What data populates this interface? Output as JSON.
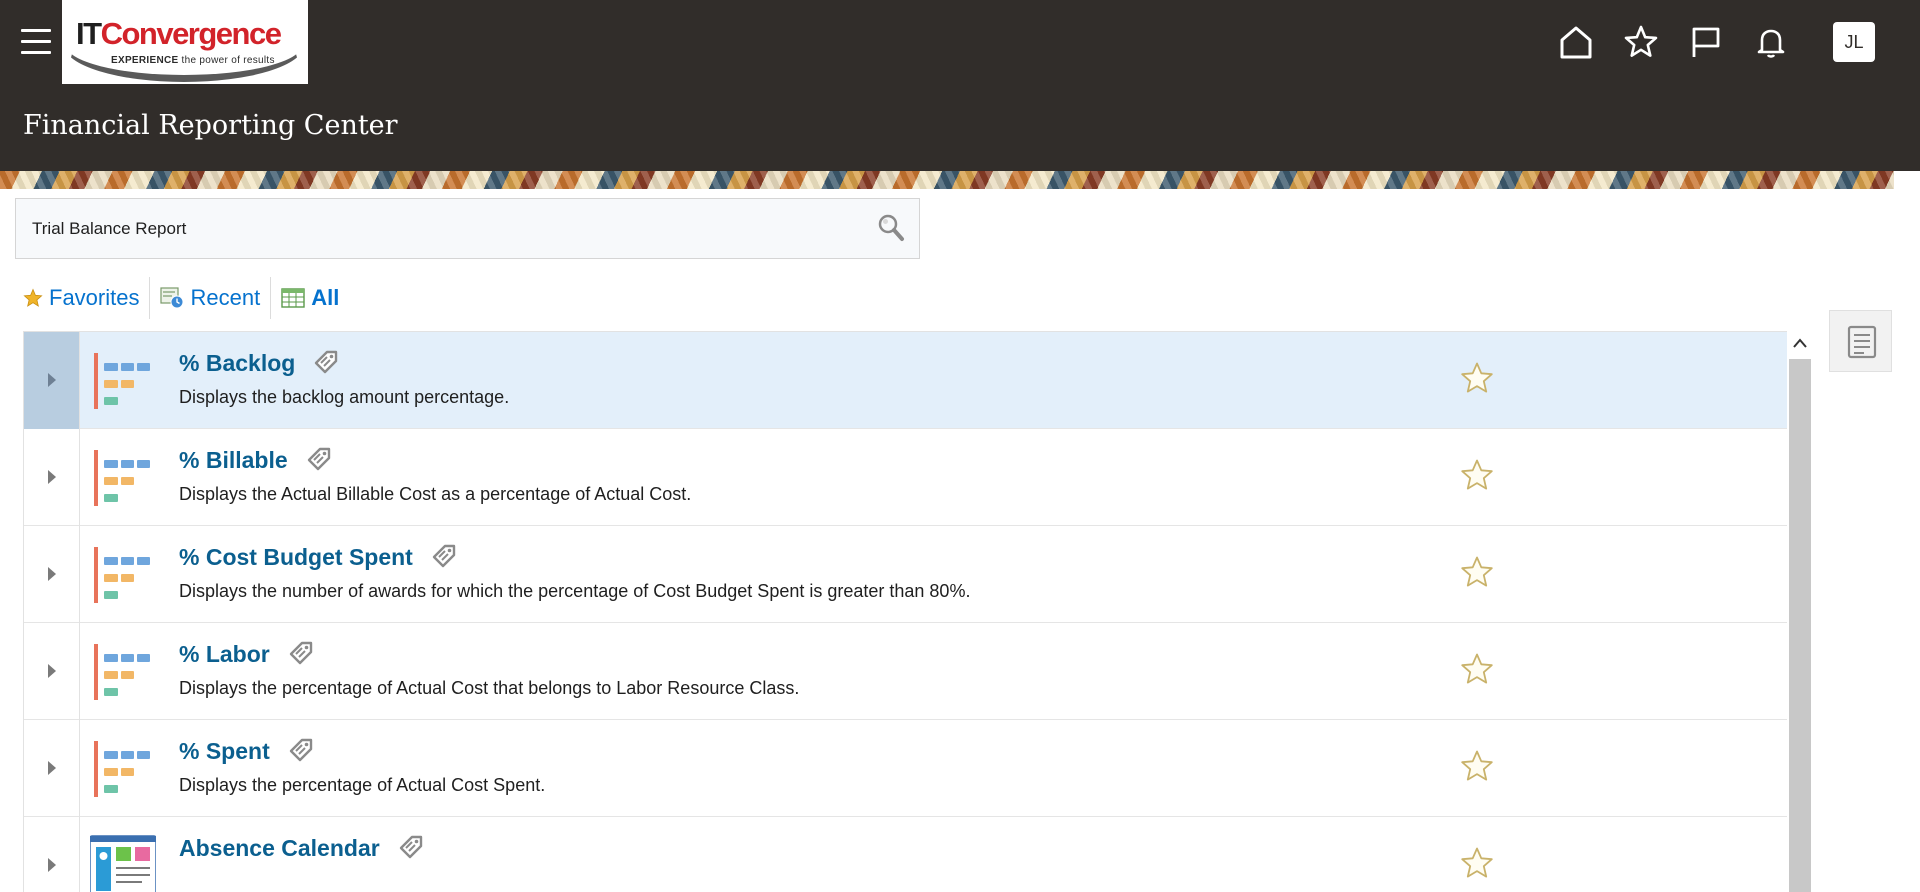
{
  "header": {
    "menu_icon": "hamburger-icon",
    "logo": {
      "brand_it": "IT",
      "brand_name": "Convergence",
      "tagline_bold": "EXPERIENCE",
      "tagline_rest": " the power of results"
    },
    "icons": [
      "home-icon",
      "star-icon",
      "flag-icon",
      "bell-icon"
    ],
    "avatar_initials": "JL",
    "page_title": "Financial Reporting Center"
  },
  "search": {
    "value": "Trial Balance Report",
    "icon": "search-icon"
  },
  "tabs": [
    {
      "label": "Favorites",
      "icon": "star-icon",
      "active": false
    },
    {
      "label": "Recent",
      "icon": "recent-icon",
      "active": false
    },
    {
      "label": "All",
      "icon": "table-icon",
      "active": true
    }
  ],
  "reports": [
    {
      "title": "% Backlog",
      "description": "Displays the backlog amount percentage.",
      "icon": "infolet-icon",
      "selected": true
    },
    {
      "title": "% Billable",
      "description": "Displays the Actual Billable Cost as a percentage of Actual Cost.",
      "icon": "infolet-icon",
      "selected": false
    },
    {
      "title": "% Cost Budget Spent",
      "description": "Displays the number of awards for which the percentage of Cost Budget Spent is greater than 80%.",
      "icon": "infolet-icon",
      "selected": false
    },
    {
      "title": "% Labor",
      "description": "Displays the percentage of Actual Cost that belongs to Labor Resource Class.",
      "icon": "infolet-icon",
      "selected": false
    },
    {
      "title": "% Spent",
      "description": "Displays the percentage of Actual Cost Spent.",
      "icon": "infolet-icon",
      "selected": false
    },
    {
      "title": "Absence Calendar",
      "description": "",
      "icon": "dashboard-icon",
      "selected": false
    }
  ],
  "colors": {
    "header_bg": "#312d2a",
    "link": "#0b5f8f",
    "tab_link": "#0572ce",
    "selected_row": "#e3effa",
    "star_outline": "#c9b26a"
  }
}
